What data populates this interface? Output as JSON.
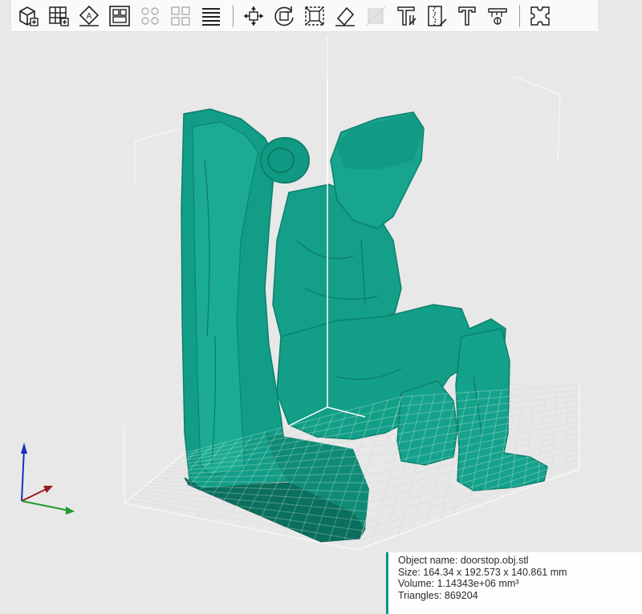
{
  "toolbar": {
    "groups": [
      [
        {
          "icon": "add-object-icon",
          "tooltip": "",
          "enabled": true
        },
        {
          "icon": "add-plate-icon",
          "tooltip": "",
          "enabled": true
        },
        {
          "icon": "auto-orient-icon",
          "tooltip": "",
          "enabled": true
        },
        {
          "icon": "arrange-icon",
          "tooltip": "",
          "enabled": true
        },
        {
          "icon": "split-objects-icon",
          "tooltip": "",
          "enabled": false
        },
        {
          "icon": "split-parts-icon",
          "tooltip": "",
          "enabled": false
        },
        {
          "icon": "variable-layer-icon",
          "tooltip": "",
          "enabled": true
        }
      ],
      [
        {
          "icon": "move-icon",
          "tooltip": "",
          "enabled": true
        },
        {
          "icon": "rotate-icon",
          "tooltip": "",
          "enabled": true
        },
        {
          "icon": "scale-icon",
          "tooltip": "",
          "enabled": true
        },
        {
          "icon": "lay-on-face-icon",
          "tooltip": "",
          "enabled": true
        },
        {
          "icon": "cut-icon",
          "tooltip": "",
          "enabled": false
        },
        {
          "icon": "support-paint-icon",
          "tooltip": "",
          "enabled": true
        },
        {
          "icon": "seam-paint-icon",
          "tooltip": "",
          "enabled": true
        },
        {
          "icon": "text-icon",
          "tooltip": "",
          "enabled": true
        },
        {
          "icon": "measure-icon",
          "tooltip": "",
          "enabled": true
        }
      ],
      [
        {
          "icon": "assembly-icon",
          "tooltip": "",
          "enabled": true
        }
      ]
    ]
  },
  "object_info": {
    "name_line": "Object name: doorstop.obj.stl",
    "size_line": "Size: 164.34 x 192.573 x 140.861 mm",
    "volume_line": "Volume: 1.14343e+06 mm³",
    "triangles_line": "Triangles: 869204"
  },
  "colors": {
    "model": "#139f87",
    "model_dark": "#0b7a66",
    "accent": "#009688",
    "axis_x": "#c0202a",
    "axis_y": "#1f9a2a",
    "axis_z": "#1a2fb8",
    "background": "#e8e8e8",
    "grid": "#d2d2d2"
  }
}
